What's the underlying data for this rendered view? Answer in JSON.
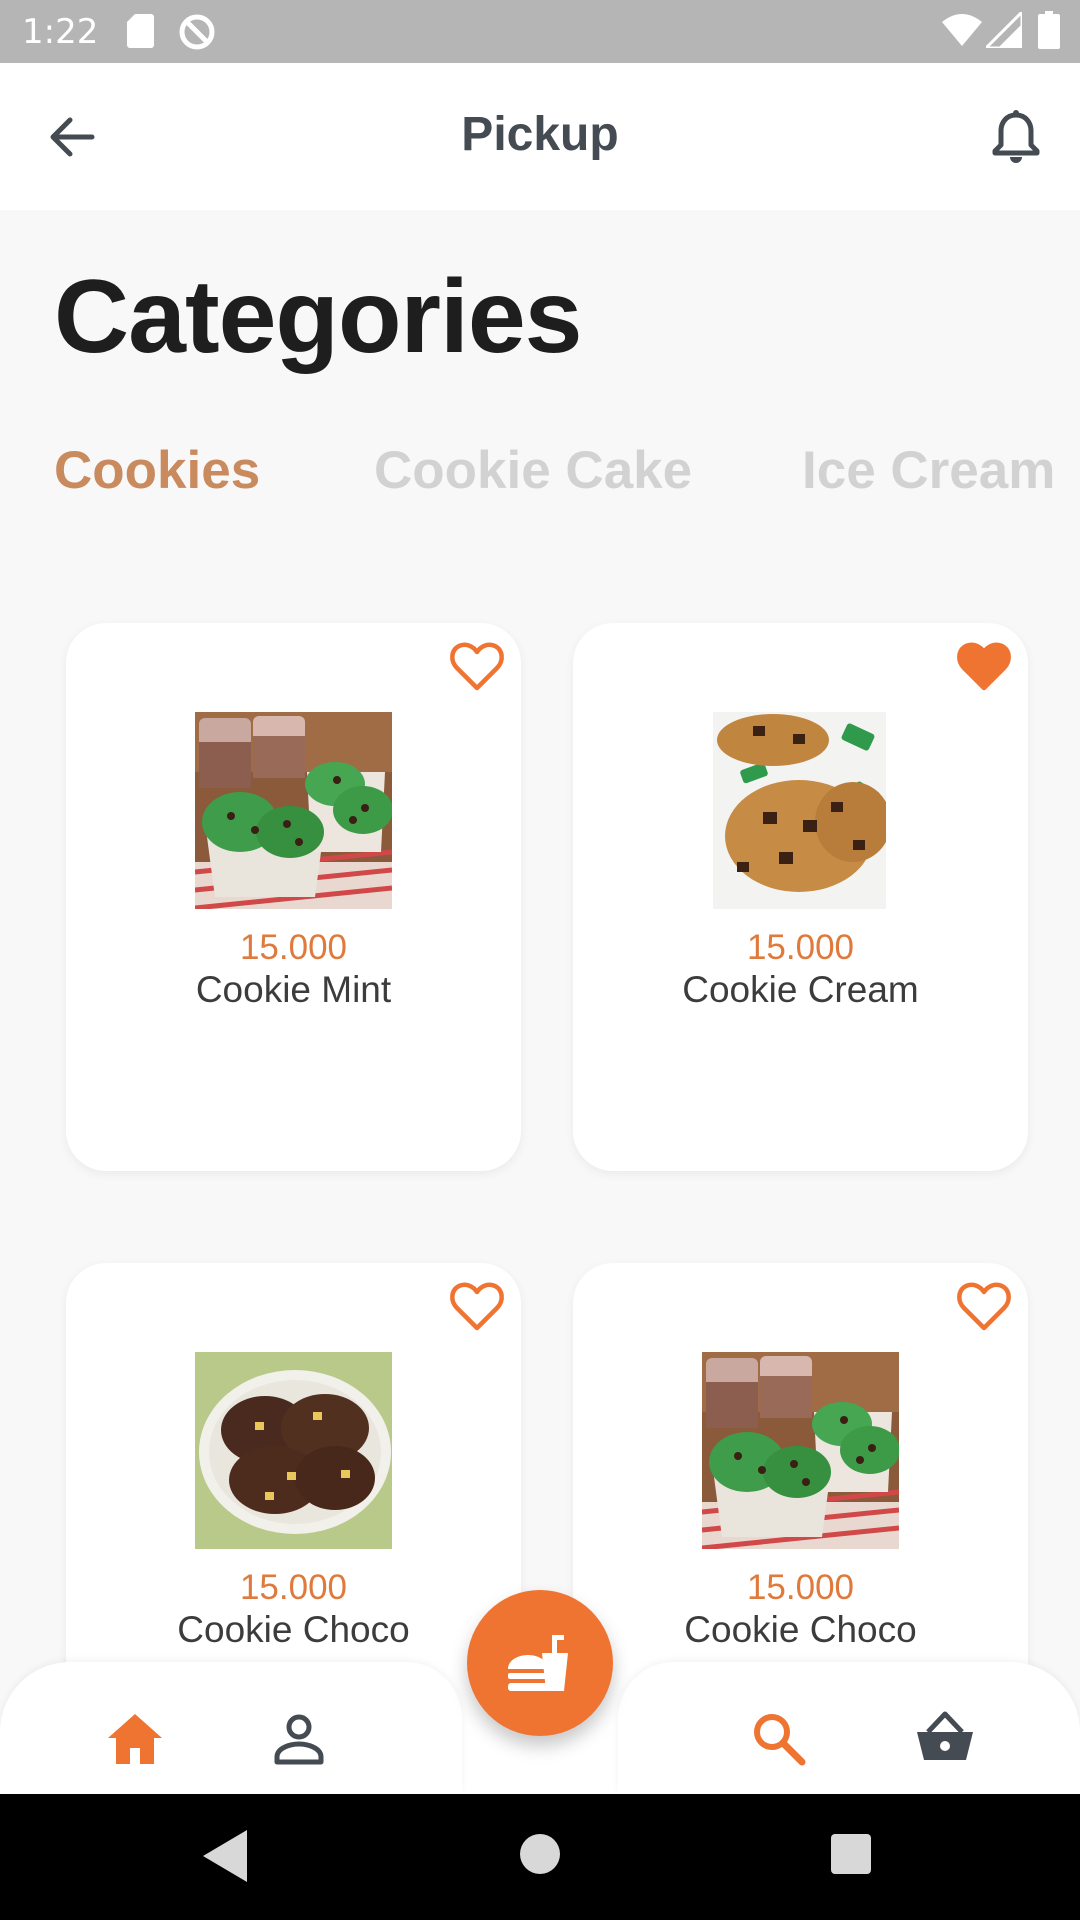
{
  "status_bar": {
    "time": "1:22"
  },
  "app_bar": {
    "title": "Pickup"
  },
  "page": {
    "title": "Categories"
  },
  "tabs": [
    {
      "label": "Cookies",
      "active": true
    },
    {
      "label": "Cookie Cake",
      "active": false
    },
    {
      "label": "Ice Cream",
      "active": false
    }
  ],
  "products": [
    {
      "price": "15.000",
      "name": "Cookie Mint",
      "favorite": false
    },
    {
      "price": "15.000",
      "name": "Cookie Cream",
      "favorite": true
    },
    {
      "price": "15.000",
      "name": "Cookie Choco",
      "favorite": false
    },
    {
      "price": "15.000",
      "name": "Cookie Choco",
      "favorite": false
    }
  ],
  "colors": {
    "accent": "#ef7432",
    "tab_active": "#c98a5e",
    "tab_inactive": "#d2d2d2",
    "price": "#e07a3c",
    "status_bar": "#b5b5b5"
  },
  "bottom_nav": {
    "items": [
      "home-icon",
      "person-icon",
      "search-icon",
      "basket-icon"
    ],
    "fab_icon": "fastfood-icon"
  }
}
